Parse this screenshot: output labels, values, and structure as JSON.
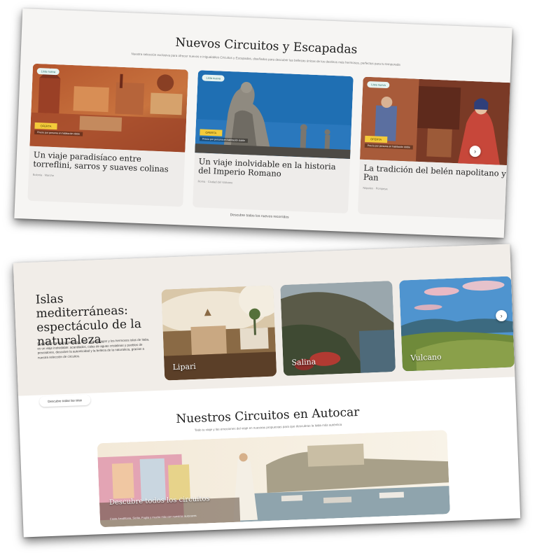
{
  "featured": {
    "title": "Nuevos Circuitos y Escapadas",
    "subtitle": "Nuestra selección exclusiva para ofrecer nuevos e inigualables Circuitos y Escapadas, diseñados para descubrir las bellezas únicas de los destinos más hermosos, perfectos para tu temporada",
    "more_link": "Descubre todos los nuevos recorridos",
    "cards": [
      {
        "tag": "Lista nueva",
        "promo": "OFERTA",
        "promo_note": "Precio por persona en habitación doble",
        "title": "Un viaje paradisíaco entre torreflini, sarros y suaves colinas",
        "location": "Bolonia · Marche"
      },
      {
        "tag": "Lista nueva",
        "promo": "OFERTA",
        "promo_note": "Precio por persona en habitación doble",
        "title": "Un viaje inolvidable en la historia del Imperio Romano",
        "location": "Roma · Ciudad del Vaticano"
      },
      {
        "tag": "Lista nueva",
        "promo": "OFERTA",
        "promo_note": "Precio por persona en habitación doble",
        "title": "La tradición del belén napolitano y Pan",
        "location": "Nápoles · Pompeya"
      }
    ],
    "next_icon": "›"
  },
  "islands": {
    "title": "Islas mediterráneas: espectáculo de la naturaleza",
    "body": "Sumérgete por la mente en los siete archipiélagos y los hermosos islas de Italia, es un viaje inolvidable: acantilados, calas de aguas cristalinas y pueblos de pescadores, descubre la autenticidad y la belleza de la naturaleza, gracias a nuestra selección de circuitos.",
    "button": "Descubre todas las islas",
    "items": [
      {
        "name": "Lipari"
      },
      {
        "name": "Salina"
      },
      {
        "name": "Vulcano"
      }
    ],
    "next_icon": "›"
  },
  "coach": {
    "title": "Nuestros Circuitos en Autocar",
    "subtitle": "Todo tu viaje y las emociones del viaje en nuestras propuestas para que descubras la Italia más auténtica",
    "banner_title": "Descubre todos los circuitos",
    "banner_sub": "Costa Amalfitana, Sicilia, Puglia y mucho más con nuestros autocares"
  }
}
